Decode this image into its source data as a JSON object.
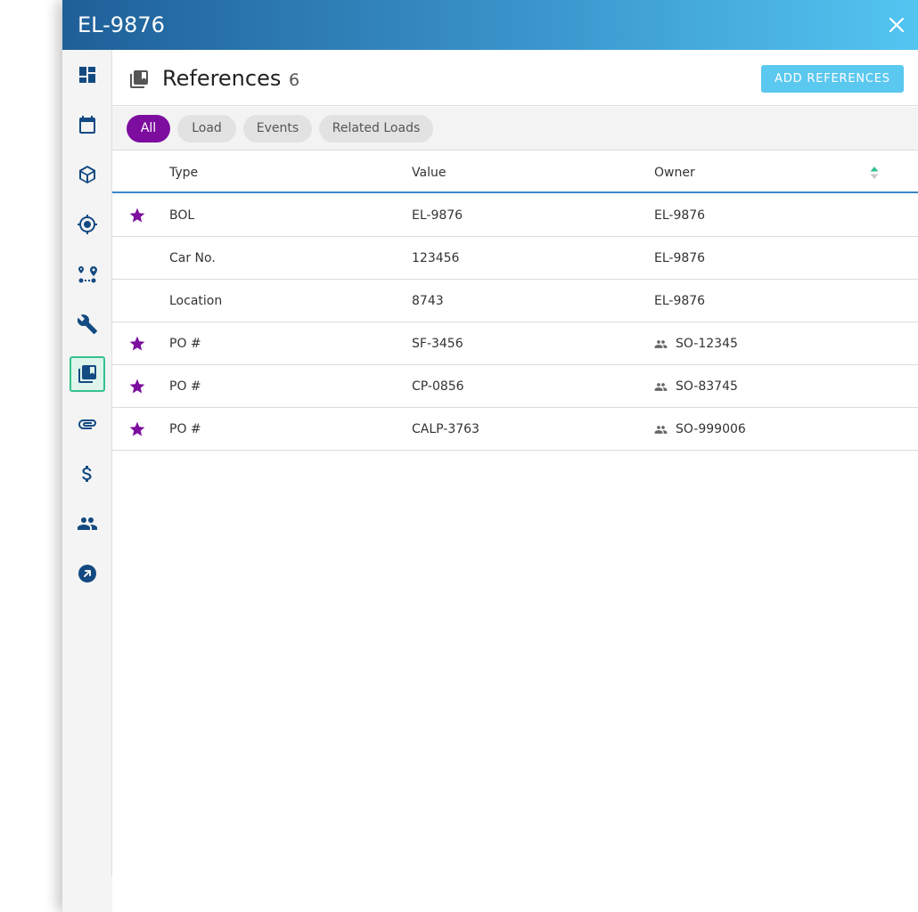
{
  "window": {
    "title": "EL-9876"
  },
  "sidebar": {
    "items": [
      {
        "icon": "dashboard-icon"
      },
      {
        "icon": "calendar-icon"
      },
      {
        "icon": "package-icon"
      },
      {
        "icon": "location-target-icon"
      },
      {
        "icon": "route-icon"
      },
      {
        "icon": "wrench-icon"
      },
      {
        "icon": "references-icon",
        "active": true
      },
      {
        "icon": "paperclip-icon"
      },
      {
        "icon": "dollar-icon"
      },
      {
        "icon": "people-icon"
      },
      {
        "icon": "external-link-icon"
      }
    ]
  },
  "references": {
    "title": "References",
    "count": "6",
    "add_label": "ADD REFERENCES"
  },
  "filters": [
    {
      "label": "All",
      "active": true
    },
    {
      "label": "Load",
      "active": false
    },
    {
      "label": "Events",
      "active": false
    },
    {
      "label": "Related Loads",
      "active": false
    }
  ],
  "table": {
    "columns": {
      "type": "Type",
      "value": "Value",
      "owner": "Owner"
    },
    "rows": [
      {
        "starred": true,
        "type": "BOL",
        "value": "EL-9876",
        "owner": "EL-9876",
        "owner_icon": false
      },
      {
        "starred": false,
        "type": "Car No.",
        "value": "123456",
        "owner": "EL-9876",
        "owner_icon": false
      },
      {
        "starred": false,
        "type": "Location",
        "value": "8743",
        "owner": "EL-9876",
        "owner_icon": false
      },
      {
        "starred": true,
        "type": "PO #",
        "value": "SF-3456",
        "owner": "SO-12345",
        "owner_icon": true
      },
      {
        "starred": true,
        "type": "PO #",
        "value": "CP-0856",
        "owner": "SO-83745",
        "owner_icon": true
      },
      {
        "starred": true,
        "type": "PO #",
        "value": "CALP-3763",
        "owner": "SO-999006",
        "owner_icon": true
      }
    ]
  },
  "colors": {
    "accent_purple": "#7c0d9e",
    "header_gradient_start": "#1f5f98",
    "header_gradient_end": "#53c5f1",
    "button_blue": "#5bc8ef",
    "active_nav_border": "#33c28c",
    "icon_navy": "#134a82"
  }
}
